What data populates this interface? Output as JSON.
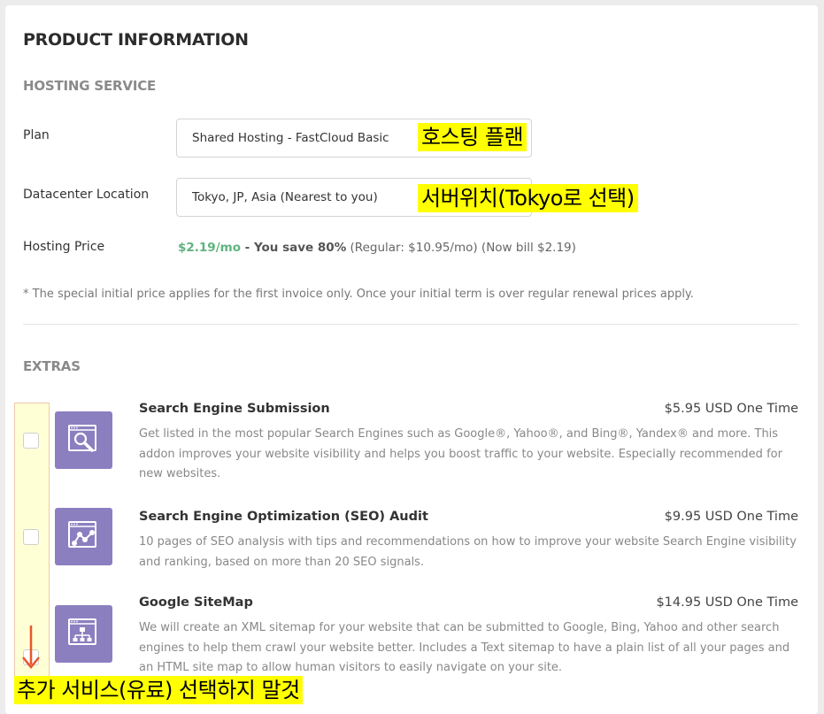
{
  "product": {
    "title": "PRODUCT INFORMATION",
    "hosting_section": "HOSTING SERVICE",
    "plan_label": "Plan",
    "plan_value": "Shared Hosting - FastCloud Basic",
    "datacenter_label": "Datacenter Location",
    "datacenter_value": "Tokyo, JP, Asia (Nearest to you)",
    "price_label": "Hosting Price",
    "price_value": "$2.19/mo",
    "price_save": " - You save 80%",
    "price_rest": " (Regular: $10.95/mo) (Now bill $2.19)",
    "note": "* The special initial price applies for the first invoice only. Once your initial term is over regular renewal prices apply."
  },
  "extras": {
    "section": "EXTRAS",
    "items": [
      {
        "name": "Search Engine Submission",
        "price": "$5.95 USD One Time",
        "description": "Get listed in the most popular Search Engines such as Google®, Yahoo®, and Bing®, Yandex® and more. This addon improves your website visibility and helps you boost traffic to your website. Especially recommended for new websites.",
        "icon": "search-icon",
        "checked": false
      },
      {
        "name": "Search Engine Optimization (SEO) Audit",
        "price": "$9.95 USD One Time",
        "description": "10 pages of SEO analysis with tips and recommendations on how to improve your website Search Engine visibility and ranking, based on more than 20 SEO signals.",
        "icon": "seo-graph-icon",
        "checked": false
      },
      {
        "name": "Google SiteMap",
        "price": "$14.95 USD One Time",
        "description": "We will create an XML sitemap for your website that can be submitted to Google, Bing, Yahoo and other search engines to help them crawl your website better. Includes a Text sitemap to have a plain list of all your pages and an HTML site map to allow human visitors to easily navigate on your site.",
        "icon": "sitemap-icon",
        "checked": false
      }
    ]
  },
  "annotations": {
    "plan": "호스팅 플랜",
    "datacenter": "서버위치(Tokyo로 선택)",
    "extras": "추가 서비스(유료) 선택하지 말것"
  },
  "colors": {
    "accent_green": "#5fb37f",
    "icon_purple": "#8b7fc0",
    "highlight_yellow": "#ffff00",
    "arrow_red": "#e8562a"
  }
}
